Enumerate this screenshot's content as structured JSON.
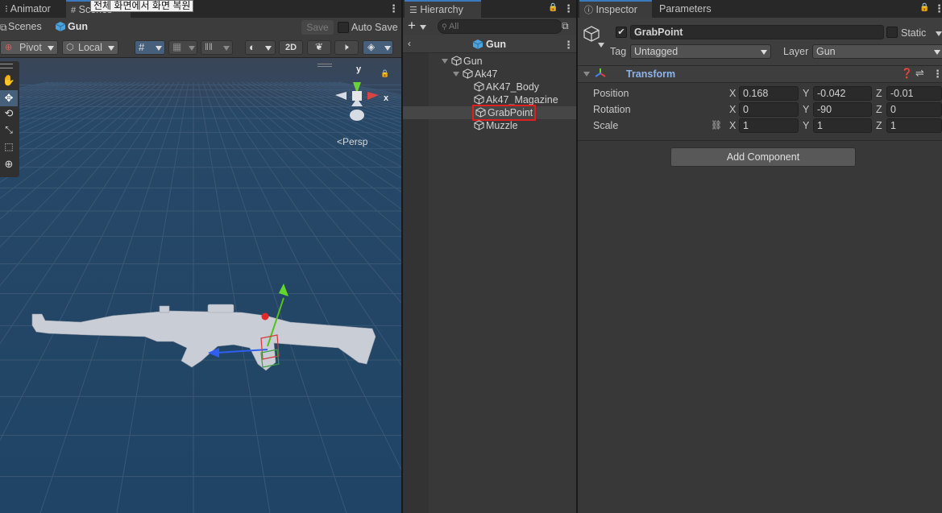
{
  "tooltip": "전체 화면에서 화면 복원",
  "scene_tabs": {
    "animator": "Animator",
    "scenes_tab": "Scenes"
  },
  "scene_toolbar": {
    "breadcrumb_root": "Scenes",
    "breadcrumb_current": "Gun",
    "save_label": "Save",
    "auto_save_label": "Auto Save",
    "auto_save_checked": false,
    "pivot_label": "Pivot",
    "local_label": "Local",
    "mode_2d_label": "2D"
  },
  "viewport": {
    "gizmo_y": "y",
    "gizmo_x": "x",
    "persp_label": "Persp",
    "sky_color": "#3a4d66",
    "grid_color": "#24405f"
  },
  "hierarchy": {
    "tab_label": "Hierarchy",
    "search_placeholder": "All",
    "header_title": "Gun",
    "items": [
      {
        "label": "Gun",
        "depth": 0,
        "expanded": true
      },
      {
        "label": "Ak47",
        "depth": 1,
        "expanded": true
      },
      {
        "label": "AK47_Body",
        "depth": 2
      },
      {
        "label": "Ak47_Magazine",
        "depth": 2
      },
      {
        "label": "GrabPoint",
        "depth": 2,
        "selected": true
      },
      {
        "label": "Muzzle",
        "depth": 2
      }
    ],
    "highlight_color": "#e01f1f"
  },
  "inspector": {
    "tab_label": "Inspector",
    "params_tab_label": "Parameters",
    "object_name": "GrabPoint",
    "active_checked": true,
    "static_label": "Static",
    "tag_label": "Tag",
    "tag_value": "Untagged",
    "layer_label": "Layer",
    "layer_value": "Gun",
    "transform_title": "Transform",
    "position_label": "Position",
    "rotation_label": "Rotation",
    "scale_label": "Scale",
    "position": {
      "x": "0.168",
      "y": "-0.042",
      "z": "-0.01"
    },
    "rotation": {
      "x": "0",
      "y": "-90",
      "z": "0"
    },
    "scale": {
      "x": "1",
      "y": "1",
      "z": "1"
    },
    "axis_x": "X",
    "axis_y": "Y",
    "axis_z": "Z",
    "add_component_label": "Add Component"
  }
}
